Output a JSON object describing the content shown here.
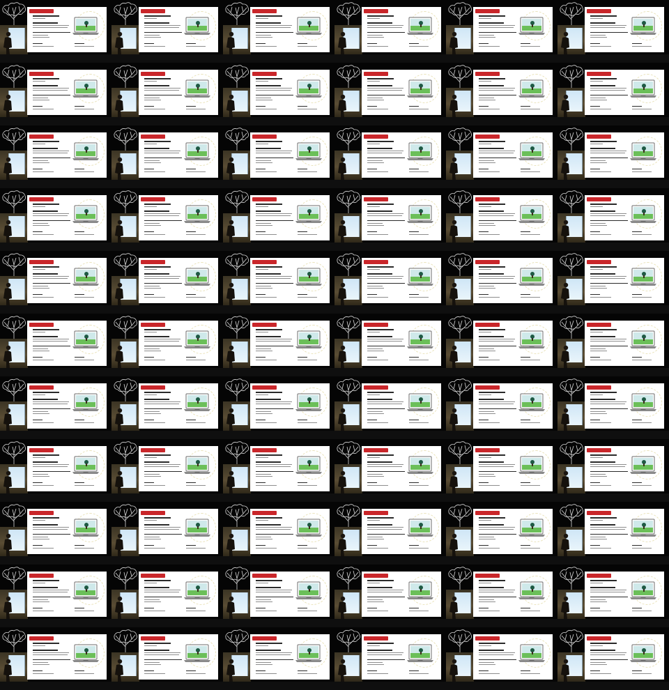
{
  "grid": {
    "rows": 11,
    "columns": 6
  },
  "tile": {
    "brand_label": "",
    "colors": {
      "page_background": "#0f0f0f",
      "brand_red": "#c9262a",
      "slide_background": "#ffffff",
      "screen_green": "#6bbf59",
      "screen_sky": "#cfe9ea",
      "tree_outline": "#d8d8d8"
    },
    "icons": [
      "tree-outline-icon",
      "laptop-icon",
      "person-icon"
    ]
  }
}
